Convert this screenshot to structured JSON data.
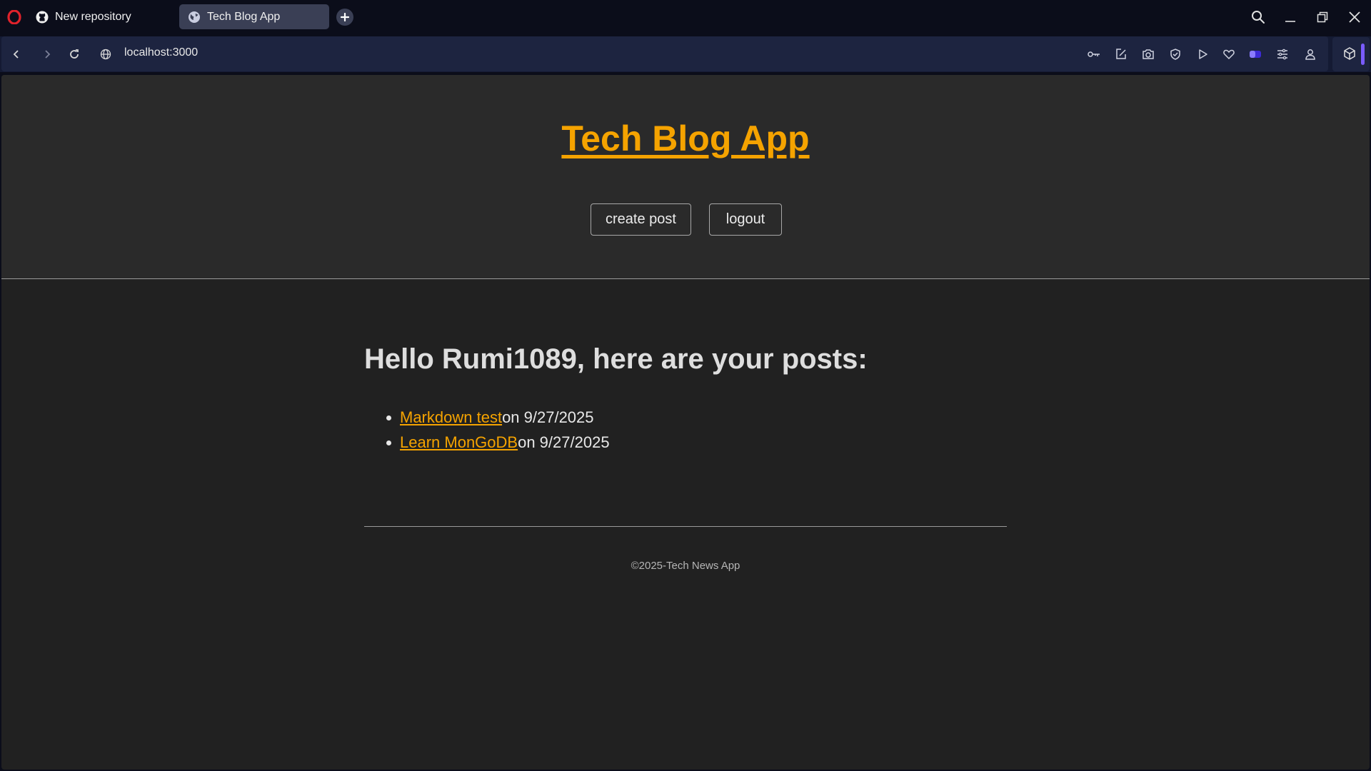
{
  "browser": {
    "tabs": [
      {
        "title": "New repository",
        "icon": "github-icon",
        "active": false
      },
      {
        "title": "Tech Blog App",
        "icon": "globe-icon",
        "active": true
      }
    ],
    "url": "localhost:3000",
    "accent_color": "#7a5cff"
  },
  "site": {
    "title": "Tech Blog App",
    "title_color": "#f5a300",
    "nav": {
      "create_post_label": "create post",
      "logout_label": "logout"
    }
  },
  "main": {
    "greeting": "Hello Rumi1089, here are your posts:",
    "posts": [
      {
        "title": "Markdown test",
        "date_text": "on 9/27/2025"
      },
      {
        "title": "Learn MonGoDB",
        "date_text": "on 9/27/2025"
      }
    ]
  },
  "footer": {
    "text": "©2025-Tech News App"
  }
}
